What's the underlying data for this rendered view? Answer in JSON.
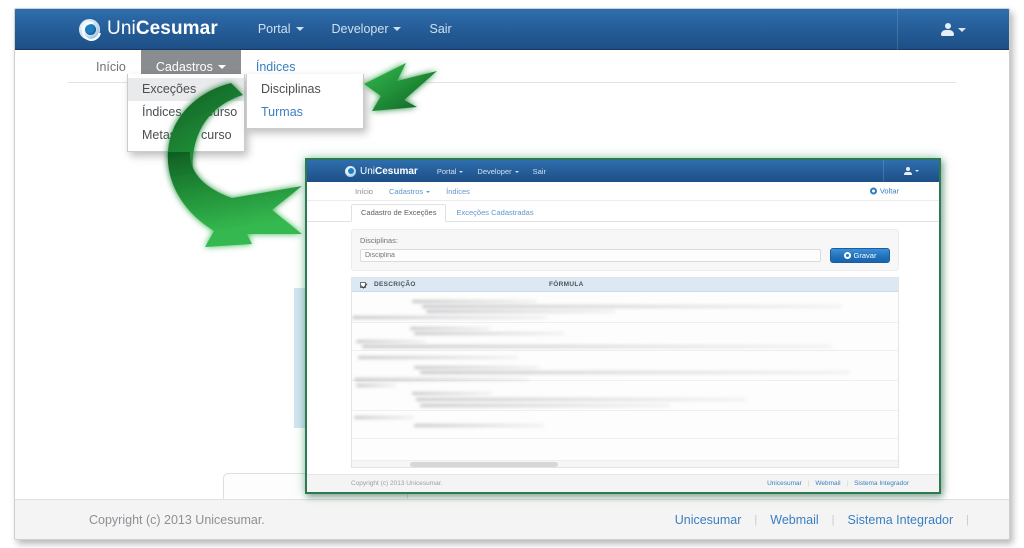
{
  "outer": {
    "navbar": {
      "brand_thin": "Uni",
      "brand_bold": "Cesumar",
      "brand_mark_icon": "unicesumar-logo-icon",
      "links": [
        {
          "label": "Portal",
          "has_caret": true
        },
        {
          "label": "Developer",
          "has_caret": true
        },
        {
          "label": "Sair",
          "has_caret": false
        }
      ],
      "user_menu_icon": "user-icon"
    },
    "subnav": [
      {
        "label": "Início",
        "state": "normal"
      },
      {
        "label": "Cadastros",
        "state": "active",
        "has_caret": true
      },
      {
        "label": "Índices",
        "state": "link"
      }
    ],
    "menu_cadastros": {
      "items": [
        {
          "label": "Exceções",
          "highlighted": true,
          "has_submenu": true
        },
        {
          "label": "Índices por curso",
          "highlighted": false,
          "has_submenu": false
        },
        {
          "label": "Metas por curso",
          "highlighted": false,
          "has_submenu": false
        }
      ]
    },
    "menu_excecoes": {
      "items": [
        {
          "label": "Disciplinas",
          "highlighted": false
        },
        {
          "label": "Turmas",
          "highlighted": true
        }
      ]
    },
    "footer": {
      "copyright": "Copyright (c) 2013 Unicesumar.",
      "links": [
        "Unicesumar",
        "Webmail",
        "Sistema Integrador"
      ]
    }
  },
  "inner": {
    "navbar": {
      "brand_thin": "Uni",
      "brand_bold": "Cesumar",
      "brand_mark_icon": "unicesumar-logo-icon",
      "links": [
        {
          "label": "Portal",
          "has_caret": true
        },
        {
          "label": "Developer",
          "has_caret": true
        },
        {
          "label": "Sair",
          "has_caret": false
        }
      ],
      "user_menu_icon": "user-icon"
    },
    "subnav": [
      {
        "label": "Início",
        "state": "normal"
      },
      {
        "label": "Cadastros",
        "state": "link",
        "has_caret": true
      },
      {
        "label": "Índices",
        "state": "link"
      }
    ],
    "back_link": {
      "label": "Voltar",
      "icon": "back-circle-icon"
    },
    "tabs": [
      {
        "label": "Cadastro de Exceções",
        "active": true
      },
      {
        "label": "Exceções Cadastradas",
        "active": false
      }
    ],
    "form": {
      "field_label": "Disciplinas:",
      "input_value": "",
      "input_placeholder": "Disciplina",
      "save_label": "Gravar",
      "save_icon": "save-circle-icon"
    },
    "table": {
      "select_all_icon": "checkbox-checked-icon",
      "columns": [
        "DESCRIÇÃO",
        "FÓRMULA"
      ],
      "rows_note": "blurred/redacted content"
    },
    "footer": {
      "copyright": "Copyright (c) 2013 Unicesumar.",
      "links": [
        "Unicesumar",
        "Webmail",
        "Sistema Integrador"
      ]
    }
  },
  "annotations": {
    "arrow_big": {
      "name": "green-curved-arrow",
      "color": "#1f8a36",
      "direction": "down-right"
    },
    "arrow_small": {
      "name": "green-left-arrow",
      "color": "#1f9b3a",
      "direction": "left"
    }
  },
  "theme": {
    "navy": "#27609c",
    "link_blue": "#3a7fc1",
    "green_accent": "#2d7a52",
    "table_header_blue": "#dce9f5"
  }
}
